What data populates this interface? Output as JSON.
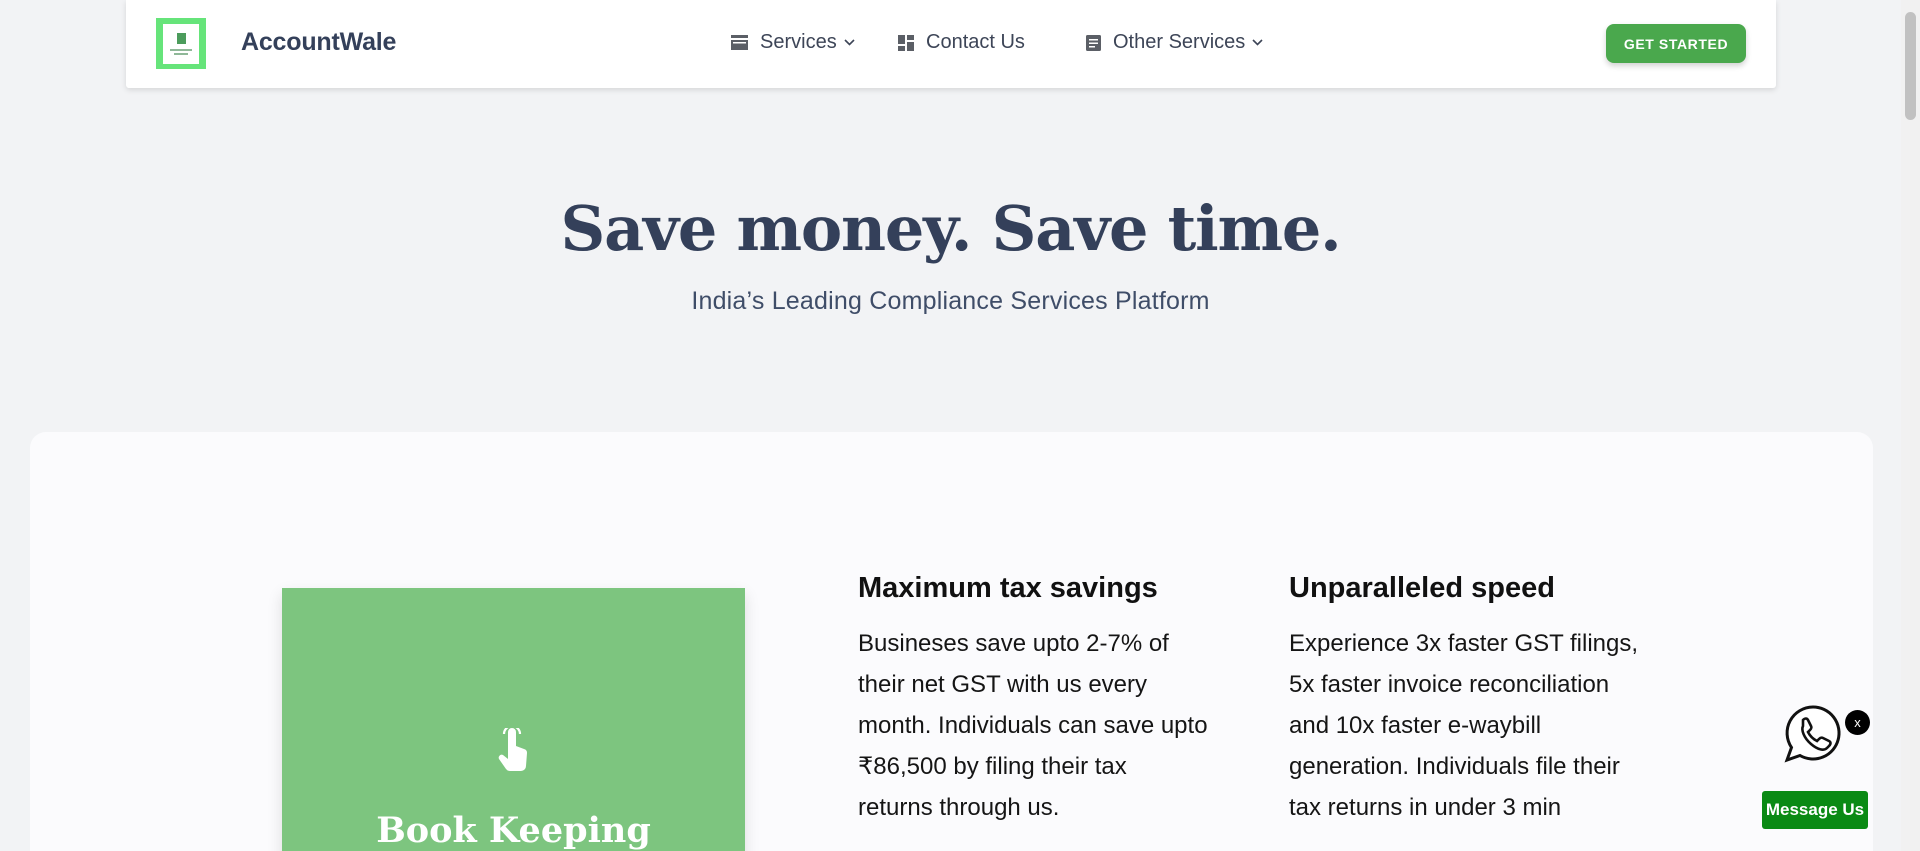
{
  "brand": {
    "name": "AccountWale",
    "logo_color": "#66e47a"
  },
  "nav": {
    "services": {
      "label": "Services",
      "icon": "stack-icon"
    },
    "contact": {
      "label": "Contact Us",
      "icon": "dashboard-icon"
    },
    "other": {
      "label": "Other Services",
      "icon": "document-icon"
    }
  },
  "cta": {
    "label": "GET STARTED",
    "color": "#4aa84d"
  },
  "hero": {
    "title": "Save money. Save time.",
    "subtitle": "India’s Leading Compliance Services Platform"
  },
  "feature_tile": {
    "title": "Book Keeping",
    "icon": "pointer-hand-icon",
    "color": "#7dc57f"
  },
  "features": [
    {
      "heading": "Maximum tax savings",
      "body": "Busineses save upto 2-7% of their net GST with us every month. Individuals can save upto ₹86,500 by filing their tax returns through us."
    },
    {
      "heading": "Unparalleled speed",
      "body": "Experience 3x faster GST filings, 5x faster invoice reconciliation and 10x faster e-waybill generation. Individuals file their tax returns in under 3 min"
    }
  ],
  "widgets": {
    "whatsapp_icon": "whatsapp-icon",
    "close_label": "x",
    "message_label": "Message Us",
    "message_color": "#0a8a14"
  }
}
